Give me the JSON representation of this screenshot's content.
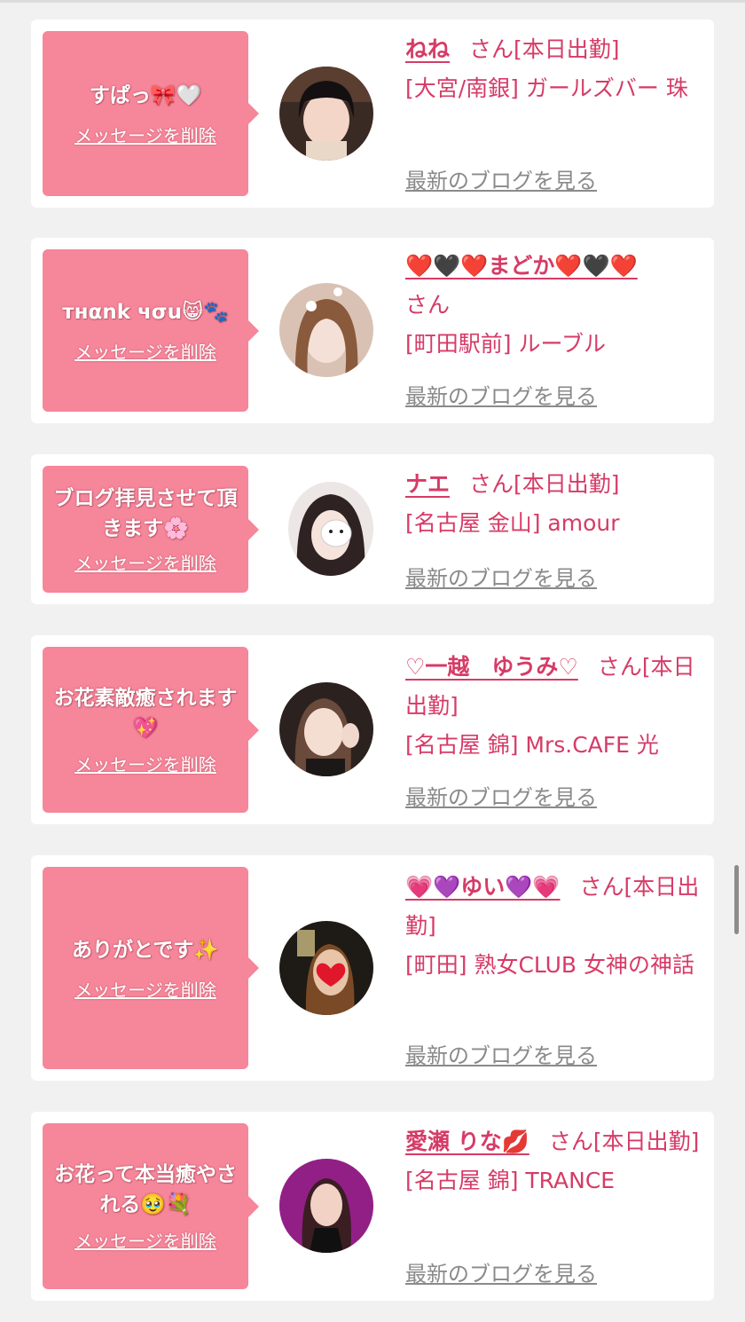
{
  "delete_label": "メッセージを削除",
  "blog_label": "最新のブログを見る",
  "san_label": "さん",
  "colors": {
    "accent_pink": "#f6869a",
    "name_text": "#d63b66",
    "muted_link": "#8a8a8a",
    "page_bg": "#f1f1f1"
  },
  "messages": [
    {
      "message": "すぱっ🎀🤍",
      "name": "ねね",
      "status": "[本日出勤]",
      "shop": "[大宮/南銀] ガールズバー 珠"
    },
    {
      "message": "тнαnk чσu😸🐾",
      "name": "❤️🖤❤️まどか❤️🖤❤️",
      "status": "",
      "shop": "[町田駅前] ルーブル"
    },
    {
      "message": "ブログ拝見させて頂きます🌸",
      "name": "ナエ",
      "status": "[本日出勤]",
      "shop": "[名古屋 金山] amour"
    },
    {
      "message": "お花素敵癒されます💖",
      "name": "♡一越　ゆうみ♡",
      "status": "[本日出勤]",
      "shop": "[名古屋 錦] Mrs.CAFE 光"
    },
    {
      "message": "ありがとです✨",
      "name": "💗💜ゆい💜💗",
      "status": "[本日出勤]",
      "shop": "[町田] 熟女CLUB 女神の神話"
    },
    {
      "message": "お花って本当癒やされる🥹💐",
      "name": "愛瀬 りな💋",
      "status": "[本日出勤]",
      "shop": "[名古屋 錦] TRANCE"
    }
  ]
}
